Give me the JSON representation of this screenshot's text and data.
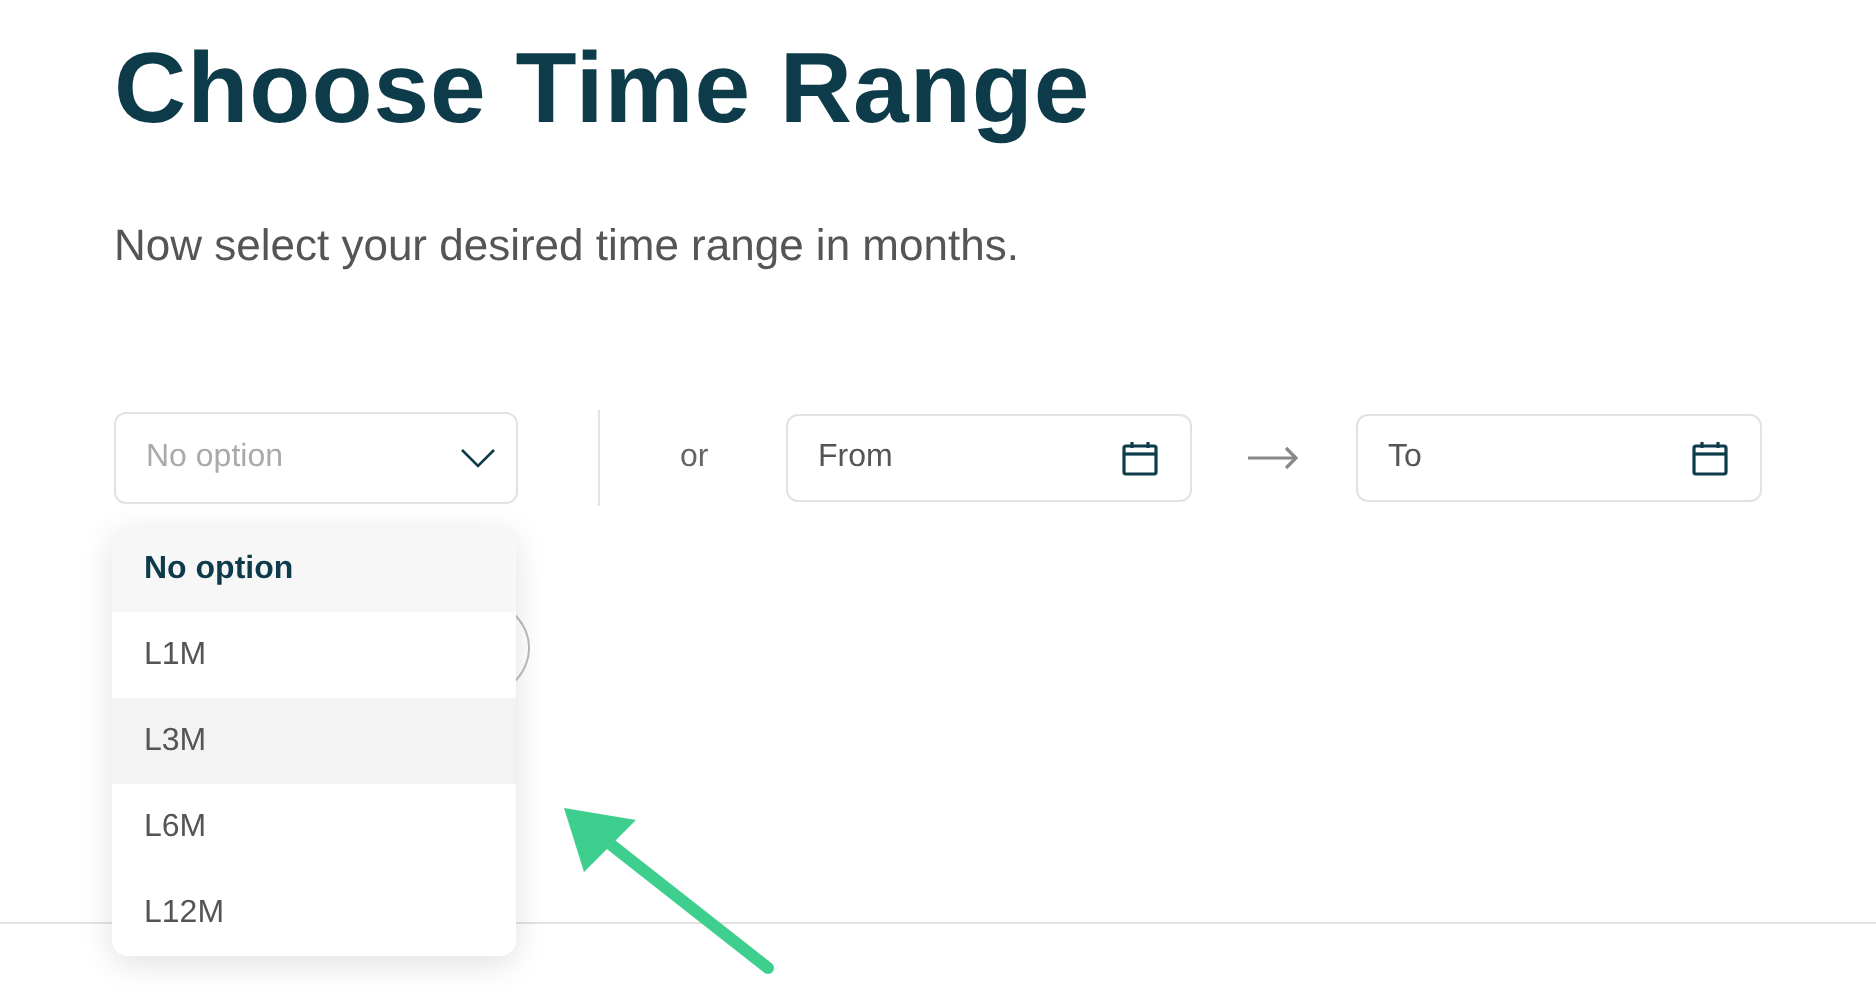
{
  "title": "Choose Time Range",
  "subtitle": "Now select your desired time range in months.",
  "select": {
    "placeholder": "No option",
    "expanded": true,
    "options": [
      {
        "label": "No option",
        "selected": true,
        "hovered": false
      },
      {
        "label": "L1M",
        "selected": false,
        "hovered": false
      },
      {
        "label": "L3M",
        "selected": false,
        "hovered": true
      },
      {
        "label": "L6M",
        "selected": false,
        "hovered": false
      },
      {
        "label": "L12M",
        "selected": false,
        "hovered": false
      }
    ]
  },
  "separator": "or",
  "from_field": {
    "placeholder": "From"
  },
  "to_field": {
    "placeholder": "To"
  }
}
